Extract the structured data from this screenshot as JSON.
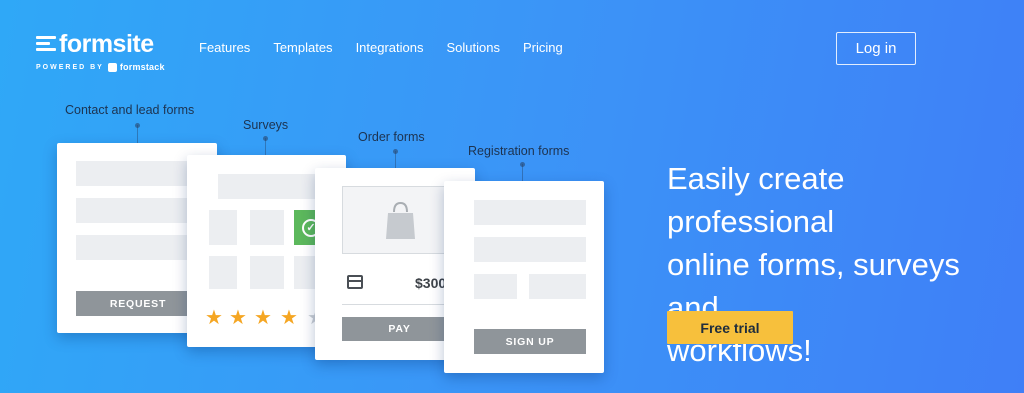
{
  "brand": {
    "name": "formsite",
    "powered_by": "POWERED BY",
    "parent": "formstack"
  },
  "nav": [
    "Features",
    "Templates",
    "Integrations",
    "Solutions",
    "Pricing"
  ],
  "login_label": "Log in",
  "hero": {
    "lines": [
      "Easily create professional",
      "online forms, surveys and",
      "workflows!"
    ],
    "cta": "Free trial"
  },
  "cards": {
    "contact": {
      "label": "Contact and lead forms",
      "button": "REQUEST"
    },
    "surveys": {
      "label": "Surveys",
      "rating": 4,
      "rating_max": 5
    },
    "order": {
      "label": "Order forms",
      "price": "$300",
      "button": "PAY"
    },
    "registration": {
      "label": "Registration forms",
      "button": "SIGN UP"
    }
  },
  "colors": {
    "cta": "#f7c03c",
    "star_on": "#f5a623",
    "star_off": "#c9cdd2",
    "check": "#5cb85c"
  }
}
